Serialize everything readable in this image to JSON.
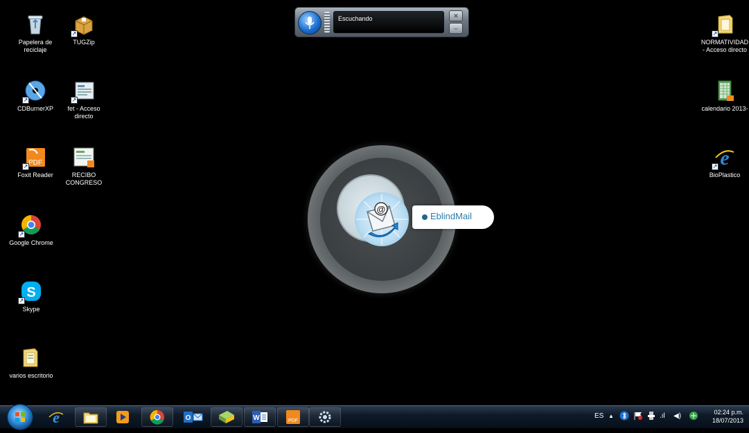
{
  "desktop_icons_left": [
    {
      "name": "recycle-bin-icon",
      "label": "Papelera de\nreciclaje"
    },
    {
      "name": "tugzip-icon",
      "label": "TUGZip"
    },
    {
      "name": "cdburnerxp-icon",
      "label": "CDBurnerXP"
    },
    {
      "name": "fet-icon",
      "label": "fet - Acceso\ndirecto"
    },
    {
      "name": "foxit-reader-icon",
      "label": "Foxit Reader"
    },
    {
      "name": "recibo-congreso-icon",
      "label": "RECIBO\nCONGRESO"
    },
    {
      "name": "google-chrome-icon",
      "label": "Google Chrome"
    },
    {
      "name": "skype-icon",
      "label": "Skype"
    },
    {
      "name": "folder-icon",
      "label": "varios escritorio"
    }
  ],
  "desktop_icons_right": [
    {
      "name": "folder-shortcut-icon",
      "label": "NORMATIVIDAD\n- Acceso directo"
    },
    {
      "name": "spreadsheet-icon",
      "label": "calendario 2013-"
    },
    {
      "name": "internet-explorer-icon",
      "label": "BioPlastico"
    }
  ],
  "speech_bar": {
    "status": "Escuchando",
    "close_label": "✕",
    "minimize_label": "–"
  },
  "dock": {
    "app_label": "EblindMail"
  },
  "taskbar": {
    "apps": [
      "internet-explorer",
      "file-explorer",
      "media-player",
      "google-chrome",
      "outlook",
      "paint",
      "word",
      "foxit-reader",
      "settings"
    ],
    "tray": {
      "language": "ES",
      "arrow": "▲",
      "signal": ".ıl",
      "volume": "◀)"
    },
    "clock": {
      "time": "02:24 p.m.",
      "date": "18/07/2013"
    }
  },
  "colors": {
    "taskbar_top": "#2a3a4e",
    "accent": "#2a7ea8",
    "desktop_bg": "#000000"
  }
}
